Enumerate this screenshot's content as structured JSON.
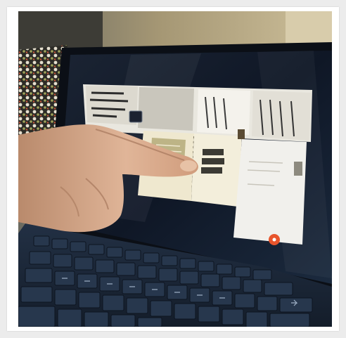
{
  "image": {
    "subject": "tablet-with-keyboard-cover",
    "screen_app": "note-taking",
    "colors": {
      "background_wall": "#b9a77e",
      "keyboard": "#1d2a3c",
      "screen_dark": "#0e1522",
      "note_page": "#efe8cf",
      "tile_white": "#f1f0ec",
      "accent_orange": "#e8552c",
      "skin": "#d2a585"
    }
  }
}
